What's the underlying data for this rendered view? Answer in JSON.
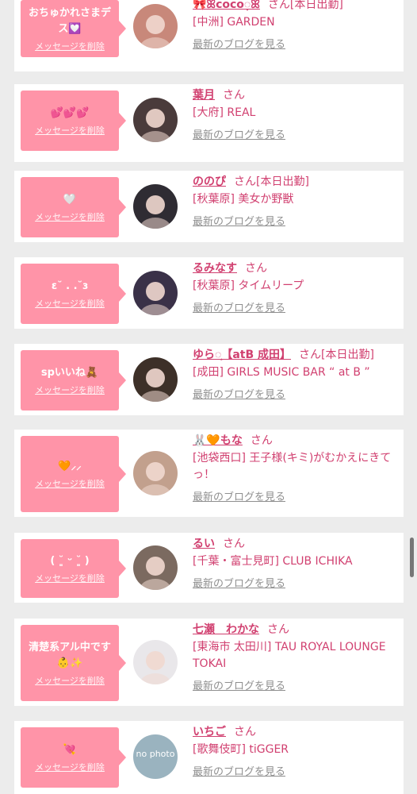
{
  "delete_label": "メッセージを削除",
  "blog_label": "最新のブログを見る",
  "san_label": "さん",
  "messages": [
    {
      "message": "おちゅかれさまデス💟",
      "name": "🎀ꕤcoco◌͙ꕤ",
      "san_suffix": "さん[本日出勤]",
      "shop": "[中洲] GARDEN",
      "avatar_color": "#c8887a"
    },
    {
      "message": "💕💕💕",
      "name": "葉月",
      "san_suffix": "さん",
      "shop": "[大府] REAL",
      "avatar_color": "#4a3b3b"
    },
    {
      "message": "🤍",
      "name": "ののぴ",
      "san_suffix": "さん[本日出勤]",
      "shop": "[秋葉原] 美女か野獣",
      "avatar_color": "#2f2c33"
    },
    {
      "message": "ɛ˘ . .˘ɜ",
      "name": "るみなす",
      "san_suffix": "さん",
      "shop": "[秋葉原] タイムリープ",
      "avatar_color": "#3a3148"
    },
    {
      "message": "spいいね🧸",
      "name": "ゆら◌͙【atB 成田】",
      "san_suffix": "さん[本日出勤]",
      "shop": "[成田] GIRLS MUSIC BAR “ at B ”",
      "avatar_color": "#3d3028"
    },
    {
      "message": "🧡⸝⸝",
      "name": "🐰🧡もな",
      "san_suffix": "さん",
      "shop": "[池袋西口] 王子様(キミ)がむかえにきてっ！",
      "avatar_color": "#c2a08d"
    },
    {
      "message": "( ˘͈ ᵕ ˘͈ )",
      "name": "るい",
      "san_suffix": "さん",
      "shop": "[千葉・富士見町] CLUB ICHIKA",
      "avatar_color": "#7b6a60"
    },
    {
      "message": "清楚系アル中です👶✨",
      "name": "七瀬　わかな",
      "san_suffix": "さん",
      "shop": "[東海市 太田川] TAU ROYAL LOUNGE TOKAI",
      "avatar_color": "#e9e7ea"
    },
    {
      "message": "💘",
      "name": "いちご",
      "san_suffix": "さん",
      "shop": "[歌舞伎町] tiGGER",
      "avatar_color": "#9ab3bf",
      "avatar_text": "no photo"
    }
  ]
}
